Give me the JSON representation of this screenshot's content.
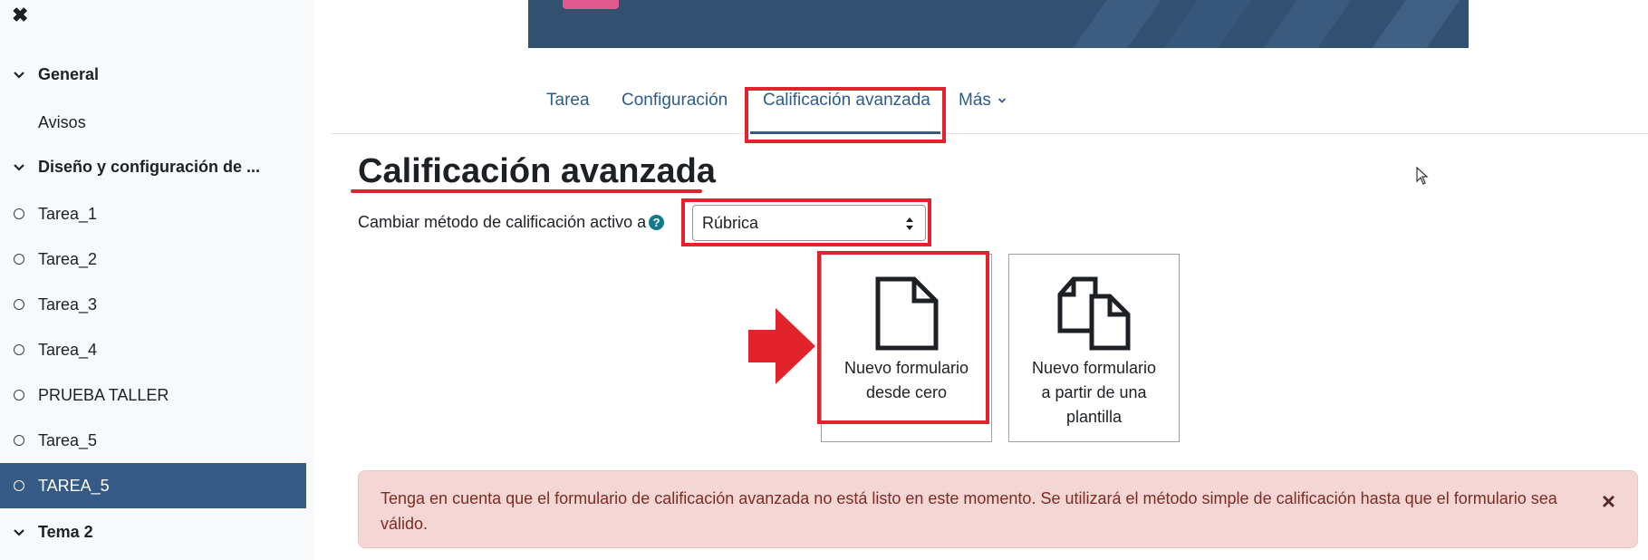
{
  "sidebar": {
    "close_glyph": "✖",
    "sections": [
      {
        "label": "General",
        "icon": "chevron-down-icon"
      },
      {
        "label": "Diseño y configuración de ...",
        "icon": "chevron-down-icon"
      },
      {
        "label": "Tema 2",
        "icon": "chevron-down-icon"
      }
    ],
    "plain_item": "Avisos",
    "items": [
      {
        "label": "Tarea_1",
        "active": false
      },
      {
        "label": "Tarea_2",
        "active": false
      },
      {
        "label": "Tarea_3",
        "active": false
      },
      {
        "label": "Tarea_4",
        "active": false
      },
      {
        "label": "PRUEBA TALLER",
        "active": false
      },
      {
        "label": "Tarea_5",
        "active": false
      },
      {
        "label": "TAREA_5",
        "active": true
      }
    ]
  },
  "tabs": [
    {
      "label": "Tarea"
    },
    {
      "label": "Configuración"
    },
    {
      "label": "Calificación avanzada",
      "active": true
    },
    {
      "label": "Más"
    }
  ],
  "page_title": "Calificación avanzada",
  "method": {
    "label": "Cambiar método de calificación activo a",
    "help_glyph": "?",
    "selected": "Rúbrica"
  },
  "cards": [
    {
      "line1": "Nuevo formulario",
      "line2": "desde cero",
      "icon": "new-document-icon"
    },
    {
      "line1": "Nuevo formulario",
      "line2": "a partir de una",
      "line3": "plantilla",
      "icon": "copy-document-icon"
    }
  ],
  "alert": {
    "text": "Tenga en cuenta que el formulario de calificación avanzada no está listo en este momento. Se utilizará el método simple de calificación hasta que el formulario sea válido.",
    "close_glyph": "×"
  },
  "colors": {
    "active_item": "#345a85",
    "highlight_red": "#e2232b",
    "alert_bg": "#f4d6d4",
    "banner": "#32506f"
  }
}
